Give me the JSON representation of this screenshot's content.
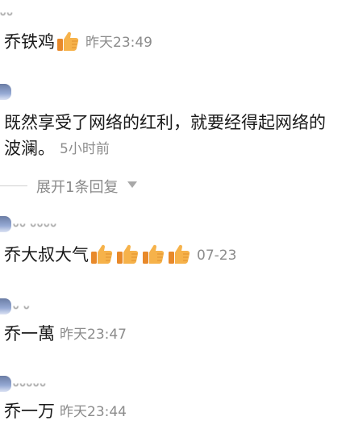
{
  "comments": [
    {
      "username": "ᴗᴗ",
      "text": "乔铁鸡",
      "thumbs": 1,
      "time": "昨天23:49"
    },
    {
      "username": "",
      "text_line1": "既然享受了网络的红利，就要经得起网络的",
      "text_line2": "波澜。",
      "time": "5小时前"
    },
    {
      "username": "ᴗᴗ ᴗᴗᴗᴗ",
      "text": "乔大叔大气",
      "thumbs": 4,
      "time": "07-23"
    },
    {
      "username": "ᴗ ᴗ",
      "text": "乔一萬",
      "time": "昨天23:47"
    },
    {
      "username": "ᴗᴗᴗᴗᴗ",
      "text": "乔一万",
      "time": "昨天23:44"
    }
  ],
  "reply_toggle": {
    "label": "展开1条回复"
  },
  "icons": {
    "thumb": "thumbs-up-emoji-icon",
    "expand": "triangle-down-icon",
    "avatar": "avatar-icon"
  },
  "colors": {
    "text": "#1a1a1a",
    "time": "#8c8c8c",
    "thumb": "#f2a33a"
  }
}
